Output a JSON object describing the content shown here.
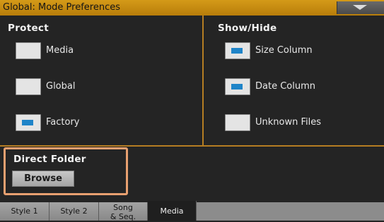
{
  "window": {
    "title": "Global: Mode Preferences"
  },
  "protect": {
    "title": "Protect",
    "items": [
      {
        "label": "Media",
        "checked": false
      },
      {
        "label": "Global",
        "checked": false
      },
      {
        "label": "Factory",
        "checked": true
      }
    ]
  },
  "show_hide": {
    "title": "Show/Hide",
    "items": [
      {
        "label": "Size Column",
        "checked": true
      },
      {
        "label": "Date Column",
        "checked": true
      },
      {
        "label": "Unknown Files",
        "checked": false
      }
    ]
  },
  "direct_folder": {
    "title": "Direct Folder",
    "button_label": "Browse"
  },
  "tabs": [
    {
      "label": "Style 1",
      "active": false
    },
    {
      "label": "Style 2",
      "active": false
    },
    {
      "line1": "Song",
      "line2": "& Seq.",
      "active": false
    },
    {
      "label": "Media",
      "active": true
    }
  ],
  "colors": {
    "title_bar": "#c88c10",
    "accent": "#b57d22",
    "check_fill": "#1f84c8",
    "highlight": "#e8a070"
  }
}
